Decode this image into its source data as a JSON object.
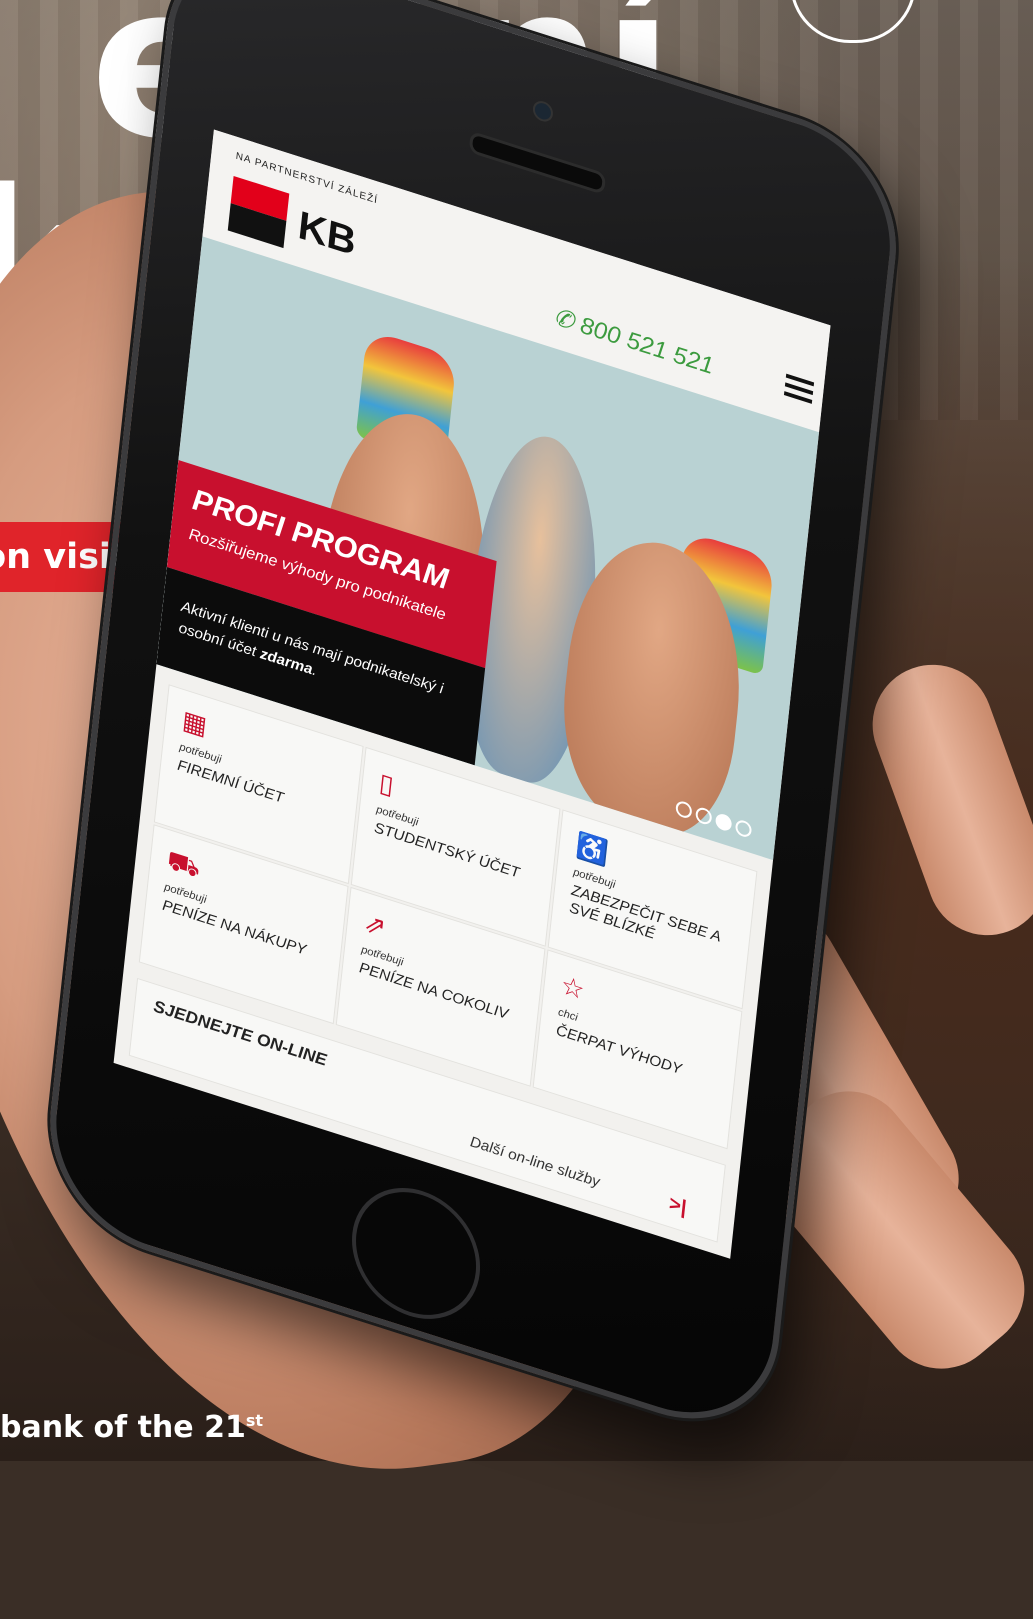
{
  "background": {
    "headline_line1": "erční",
    "headline_line2": "ka",
    "banner_text": "ion visits per month",
    "footer_text": "bank of the 21",
    "footer_sup": "st",
    "accent_red": "#e0242a"
  },
  "phone": {
    "tagline": "NA PARTNERSTVÍ ZÁLEŽÍ",
    "logo_text": "KB",
    "phone_number": "800 521 521",
    "phone_icon": "phone-icon",
    "menu_icon": "hamburger-menu-icon",
    "hero": {
      "title": "PROFI PROGRAM",
      "subtitle": "Rozšiřujeme výhody pro podnikatele",
      "body_text": "Aktivní klienti u nás mají podnikatelský i osobní účet ",
      "body_bold": "zdarma",
      "body_end": ".",
      "slide_indicators": 4,
      "active_slide": 3
    },
    "tiles": [
      {
        "icon": "cash-register-icon",
        "small": "potřebuji",
        "main": "FIREMNÍ ÚČET"
      },
      {
        "icon": "book-icon",
        "small": "potřebuji",
        "main": "STUDENTSKÝ ÚČET"
      },
      {
        "icon": "wheelchair-icon",
        "small": "potřebuji",
        "main": "ZABEZPEČIT SEBE A SVÉ BLÍZKÉ"
      },
      {
        "icon": "shopping-cart-icon",
        "small": "potřebuji",
        "main": "PENÍZE NA NÁKUPY"
      },
      {
        "icon": "money-arrow-icon",
        "small": "potřebuji",
        "main": "PENÍZE NA COKOLIV"
      },
      {
        "icon": "star-icon",
        "small": "chci",
        "main": "ČERPAT VÝHODY"
      }
    ],
    "online": {
      "title": "SJEDNEJTE ON-LINE",
      "link": "Další on-line služby"
    }
  }
}
